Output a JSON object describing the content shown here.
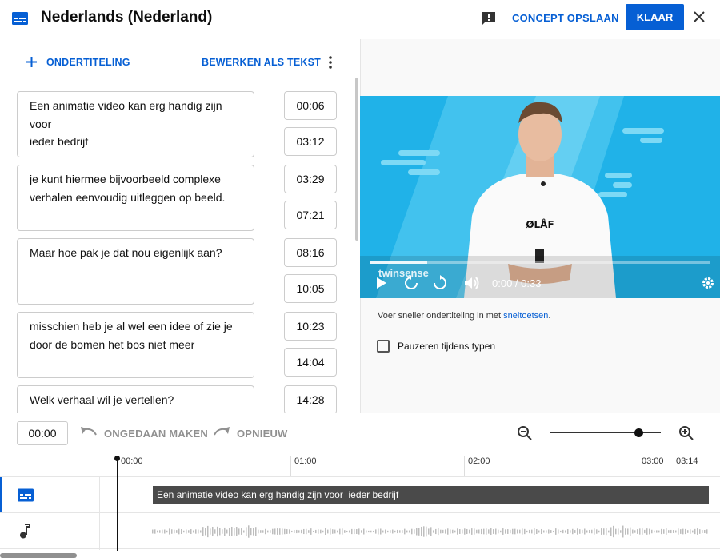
{
  "header": {
    "title": "Nederlands (Nederland)",
    "save_draft": "CONCEPT OPSLAAN",
    "done": "KLAAR"
  },
  "editor": {
    "add_subtitle": "ONDERTITELING",
    "edit_as_text": "BEWERKEN ALS TEKST",
    "cues": [
      {
        "text": "Een animatie video kan erg handig zijn\nvoor\nieder bedrijf",
        "start": "00:06",
        "end": "03:12"
      },
      {
        "text": "je kunt hiermee bijvoorbeeld complexe\nverhalen eenvoudig uitleggen op beeld.",
        "start": "03:29",
        "end": "07:21"
      },
      {
        "text": "Maar hoe pak je dat nou eigenlijk aan?",
        "start": "08:16",
        "end": "10:05"
      },
      {
        "text": "misschien heb je al wel een idee of zie je\ndoor de bomen het bos niet meer",
        "start": "10:23",
        "end": "14:04"
      },
      {
        "text": "Welk verhaal wil je vertellen?",
        "start": "14:28",
        "end": ""
      }
    ]
  },
  "player": {
    "shirt_text": "ØLÅF",
    "watermark": "twinsense",
    "time": "0:00 / 0:33",
    "progress": 0.17
  },
  "tips": {
    "shortcut_text": "Voer sneller ondertiteling in met",
    "shortcut_link": "sneltoetsen",
    "shortcut_suffix": ".",
    "pause_label": "Pauzeren tijdens typen",
    "pause_checked": false
  },
  "toolbar": {
    "current_time": "00:00",
    "undo": "ONGEDAAN MAKEN",
    "redo": "OPNIEUW",
    "zoom_level": 0.8
  },
  "timeline": {
    "ticks": [
      "00:00",
      "01:00",
      "02:00",
      "03:00",
      "03:14"
    ],
    "caption_bar": "Een animatie video kan erg handig zijn voor  ieder bedrijf"
  },
  "colors": {
    "accent": "#065fd4",
    "video_bg": "#20b2e8",
    "caption_bar": "#4a4a4a"
  }
}
